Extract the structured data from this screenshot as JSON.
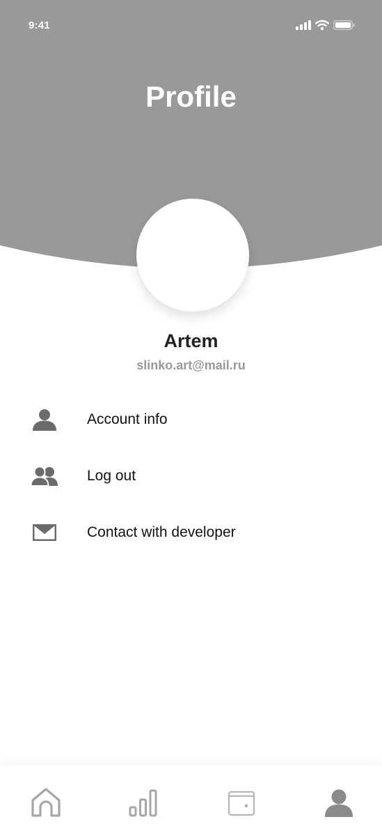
{
  "status_bar": {
    "time": "9:41",
    "icons": [
      "signal-icon",
      "wifi-icon",
      "battery-icon"
    ]
  },
  "header": {
    "title": "Profile",
    "background_color": "#999999"
  },
  "profile": {
    "name": "Artem",
    "email": "slinko.art@mail.ru"
  },
  "menu": [
    {
      "label": "Account info",
      "icon": "user-icon"
    },
    {
      "label": "Log out",
      "icon": "users-icon"
    },
    {
      "label": "Contact with developer",
      "icon": "mail-icon"
    }
  ],
  "tab_bar": {
    "tabs": [
      {
        "icon": "home-icon",
        "active": false
      },
      {
        "icon": "chart-icon",
        "active": false
      },
      {
        "icon": "wallet-icon",
        "active": false
      },
      {
        "icon": "profile-icon",
        "active": true
      }
    ],
    "active_color": "#8a8a8a",
    "inactive_color": "#a6a6a6"
  }
}
